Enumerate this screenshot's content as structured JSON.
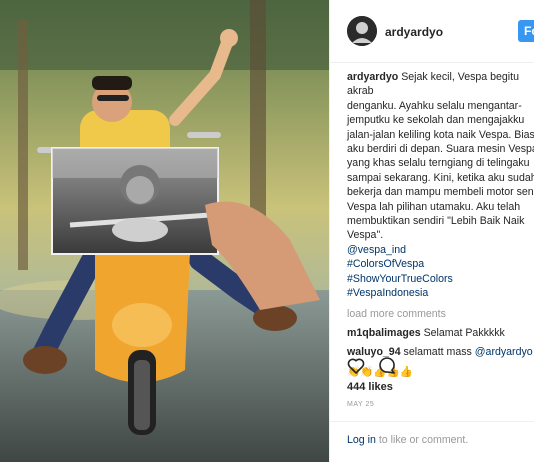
{
  "post": {
    "username": "ardyardyo",
    "follow_label": "Fo",
    "caption_user": "ardyardyo",
    "caption_lines": [
      "Sejak kecil, Vespa begitu akrab",
      "denganku. Ayahku selalu mengantar-",
      "jemputku ke sekolah dan mengajakku",
      "jalan-jalan keliling kota naik Vespa. Biasa",
      "aku berdiri di depan. Suara mesin Vespa",
      "yang khas selalu terngiang di telingaku",
      "sampai sekarang. Kini, ketika aku sudah",
      "bekerja dan mampu membeli motor send",
      "Vespa lah pilihan utamaku. Aku telah",
      "membuktikan sendiri \"Lebih Baik Naik",
      "Vespa\"."
    ],
    "caption_first_line": "Sejak kecil, Vespa begitu akrab",
    "hashtags": [
      "@vespa_ind",
      "#ColorsOfVespa",
      "#ShowYourTrueColors",
      "#VespaIndonesia"
    ],
    "load_more": "load more comments",
    "comments": [
      {
        "user": "m1qbalimages",
        "text": "Selamat Pakkkkk"
      },
      {
        "user": "waluyo_94",
        "text": "selamatt mass",
        "mention": "@ardyardyo"
      }
    ],
    "emoji_row": "👏👏👍👍👍",
    "likes": "444 likes",
    "date": "MAY 25",
    "login_link": "Log in",
    "login_text": "to like or comment."
  }
}
